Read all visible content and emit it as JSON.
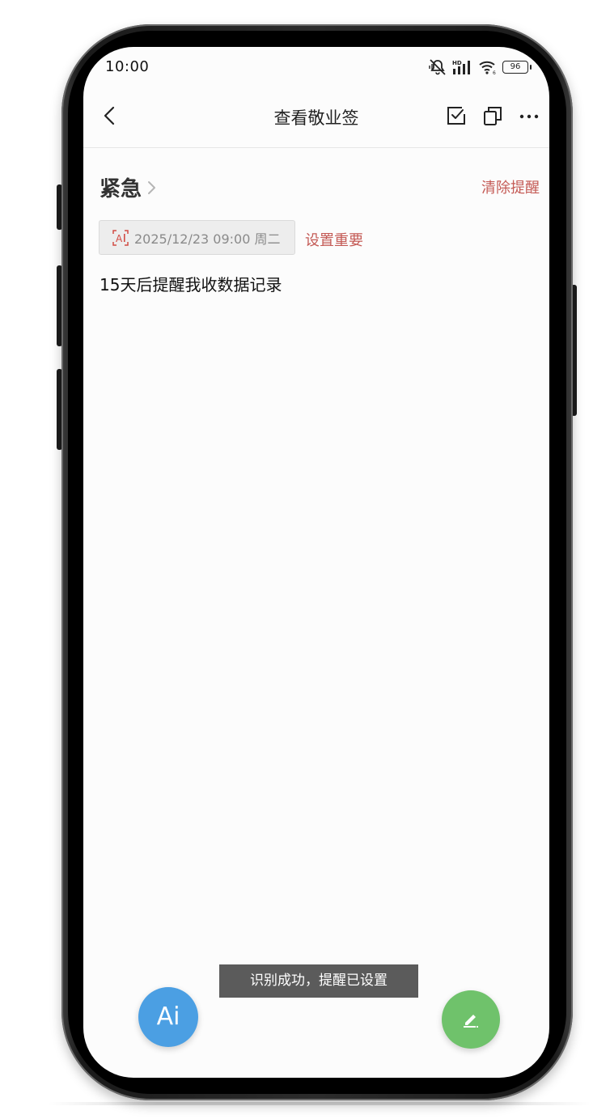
{
  "status_bar": {
    "time": "10:00",
    "battery": "96"
  },
  "toolbar": {
    "title": "查看敬业签"
  },
  "note": {
    "category": "紧急",
    "clear_reminder": "清除提醒",
    "reminder_datetime": "2025/12/23 09:00 周二",
    "set_important": "设置重要",
    "content": "15天后提醒我收数据记录"
  },
  "fab": {
    "ai_label": "Ai"
  },
  "toast": {
    "message": "识别成功，提醒已设置"
  },
  "colors": {
    "accent_red": "#c45a55",
    "fab_blue": "#4b9fe3",
    "fab_green": "#6fc26b",
    "toast_bg": "#5b5b5b"
  }
}
